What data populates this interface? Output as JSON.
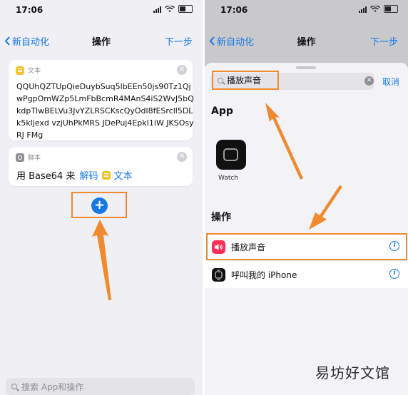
{
  "left": {
    "status": {
      "time": "17:06"
    },
    "nav": {
      "back_label": "新自动化",
      "title": "操作",
      "next_label": "下一步"
    },
    "text_card": {
      "kind_label": "文本",
      "content": "QQUhQZTUpQieDuybSuq5lbEEn50js90Tz1QjwPgpOmWZp5LmFbBcmR4MAnS4iS2WvJ5bQkdpTlwBELVu3JvYZLRSCKscQyOdl8fESrcll5DLk5kljexd vzjUhPkMRS JDePuj4EpkI1iW JKSOsyRJ F​Mg"
    },
    "script_card": {
      "kind_label": "脚本",
      "prefix": "用 Base64 来",
      "action": "解码",
      "token": "文本"
    },
    "bottom_search": {
      "placeholder": "搜索 App和操作"
    }
  },
  "right": {
    "status": {
      "time": "17:06"
    },
    "nav": {
      "back_label": "新自动化",
      "title": "操作",
      "next_label": "下一步"
    },
    "search": {
      "query": "播放声音",
      "cancel_label": "取消"
    },
    "apps_section": {
      "title": "App",
      "apps": [
        {
          "label": "Watch",
          "icon": "watch-icon"
        }
      ]
    },
    "actions_section": {
      "title": "操作",
      "items": [
        {
          "label": "播放声音",
          "icon": "speaker-icon",
          "icon_color": "#ff2d55"
        },
        {
          "label": "呼叫我的 iPhone",
          "icon": "watch-icon",
          "icon_color": "#111111"
        }
      ]
    }
  },
  "watermark": "易坊好文馆",
  "colors": {
    "accent": "#1677e5",
    "highlight": "#f08a2e"
  }
}
